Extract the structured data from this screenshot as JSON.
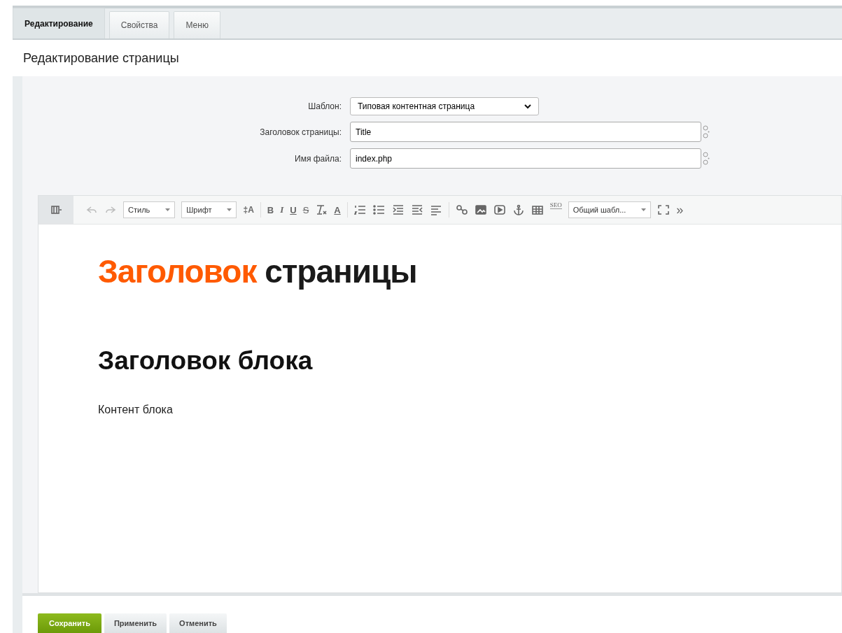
{
  "tabs": [
    {
      "label": "Редактирование",
      "selected": true
    },
    {
      "label": "Свойства",
      "selected": false
    },
    {
      "label": "Меню",
      "selected": false
    }
  ],
  "page_title": "Редактирование страницы",
  "form": {
    "template": {
      "label": "Шаблон:",
      "value": "Типовая контентная страница"
    },
    "fields": [
      {
        "label": "Заголовок страницы:",
        "value": "Title"
      },
      {
        "label": "Имя файла:",
        "value": "index.php"
      }
    ]
  },
  "toolbar": [
    [
      {
        "kind": "source",
        "disabled": false
      },
      {
        "kind": "undo",
        "disabled": true
      },
      {
        "kind": "redo",
        "disabled": true
      },
      {
        "kind": "select",
        "label": "Стиль",
        "disabled": false
      },
      {
        "kind": "select",
        "label": "Шрифт",
        "disabled": false
      },
      {
        "kind": "fontsize",
        "label": "‡A",
        "disabled": false
      }
    ],
    [
      {
        "kind": "bold",
        "label": "B",
        "disabled": false
      },
      {
        "kind": "italic",
        "label": "I",
        "disabled": false
      },
      {
        "kind": "underline",
        "label": "U",
        "disabled": false
      },
      {
        "kind": "strike",
        "label": "S",
        "disabled": false
      },
      {
        "kind": "clear",
        "disabled": false
      },
      {
        "kind": "color",
        "label": "A",
        "disabled": false
      }
    ],
    [
      {
        "kind": "olist",
        "disabled": false
      },
      {
        "kind": "ulist",
        "disabled": false
      },
      {
        "kind": "indent",
        "disabled": false
      },
      {
        "kind": "outdent",
        "disabled": false
      },
      {
        "kind": "align",
        "disabled": false
      }
    ],
    [
      {
        "kind": "link",
        "disabled": false
      },
      {
        "kind": "image",
        "disabled": false
      },
      {
        "kind": "video",
        "disabled": false
      },
      {
        "kind": "anchor",
        "disabled": false
      },
      {
        "kind": "table",
        "disabled": false
      },
      {
        "kind": "seo",
        "label": "SEO",
        "disabled": false
      },
      {
        "kind": "select",
        "label": "Общий шабл...",
        "disabled": false
      },
      {
        "kind": "fullscreen",
        "disabled": false
      },
      {
        "kind": "more",
        "label": "»",
        "disabled": false
      }
    ]
  ],
  "content": {
    "heading": {
      "accent": "Заголовок",
      "rest": "страницы"
    },
    "subheading": "Заголовок блока",
    "paragraph": "Контент блока"
  },
  "buttons": [
    {
      "label": "Сохранить",
      "kind": "primary"
    },
    {
      "label": "Применить",
      "kind": "default"
    },
    {
      "label": "Отменить",
      "kind": "default"
    }
  ]
}
